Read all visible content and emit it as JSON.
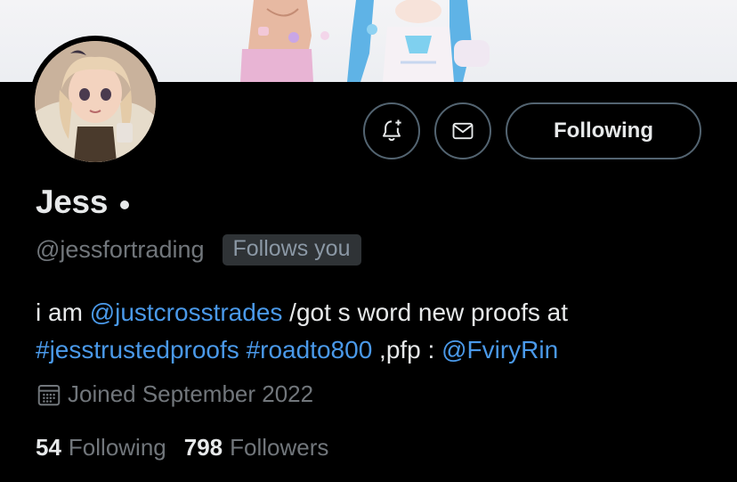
{
  "profile": {
    "display_name": "Jess",
    "handle": "@jessfortrading",
    "follows_you_label": "Follows you",
    "joined": "Joined September 2022"
  },
  "actions": {
    "notify_icon": "bell-plus-icon",
    "message_icon": "envelope-icon",
    "following_label": "Following"
  },
  "bio": {
    "part1": "i am ",
    "mention1": "@justcrosstrades",
    "part2": " /got s word new proofs at ",
    "hashtag1": "#jesstrustedproofs",
    "space": " ",
    "hashtag2": "#roadto800",
    "part3": " ,pfp : ",
    "mention2": "@FviryRin"
  },
  "stats": {
    "following_count": "54",
    "following_label": "Following",
    "followers_count": "798",
    "followers_label": "Followers"
  },
  "colors": {
    "background": "#000000",
    "text": "#e7e9ea",
    "muted": "#71767b",
    "link": "#4a99e9",
    "border": "#536471"
  }
}
